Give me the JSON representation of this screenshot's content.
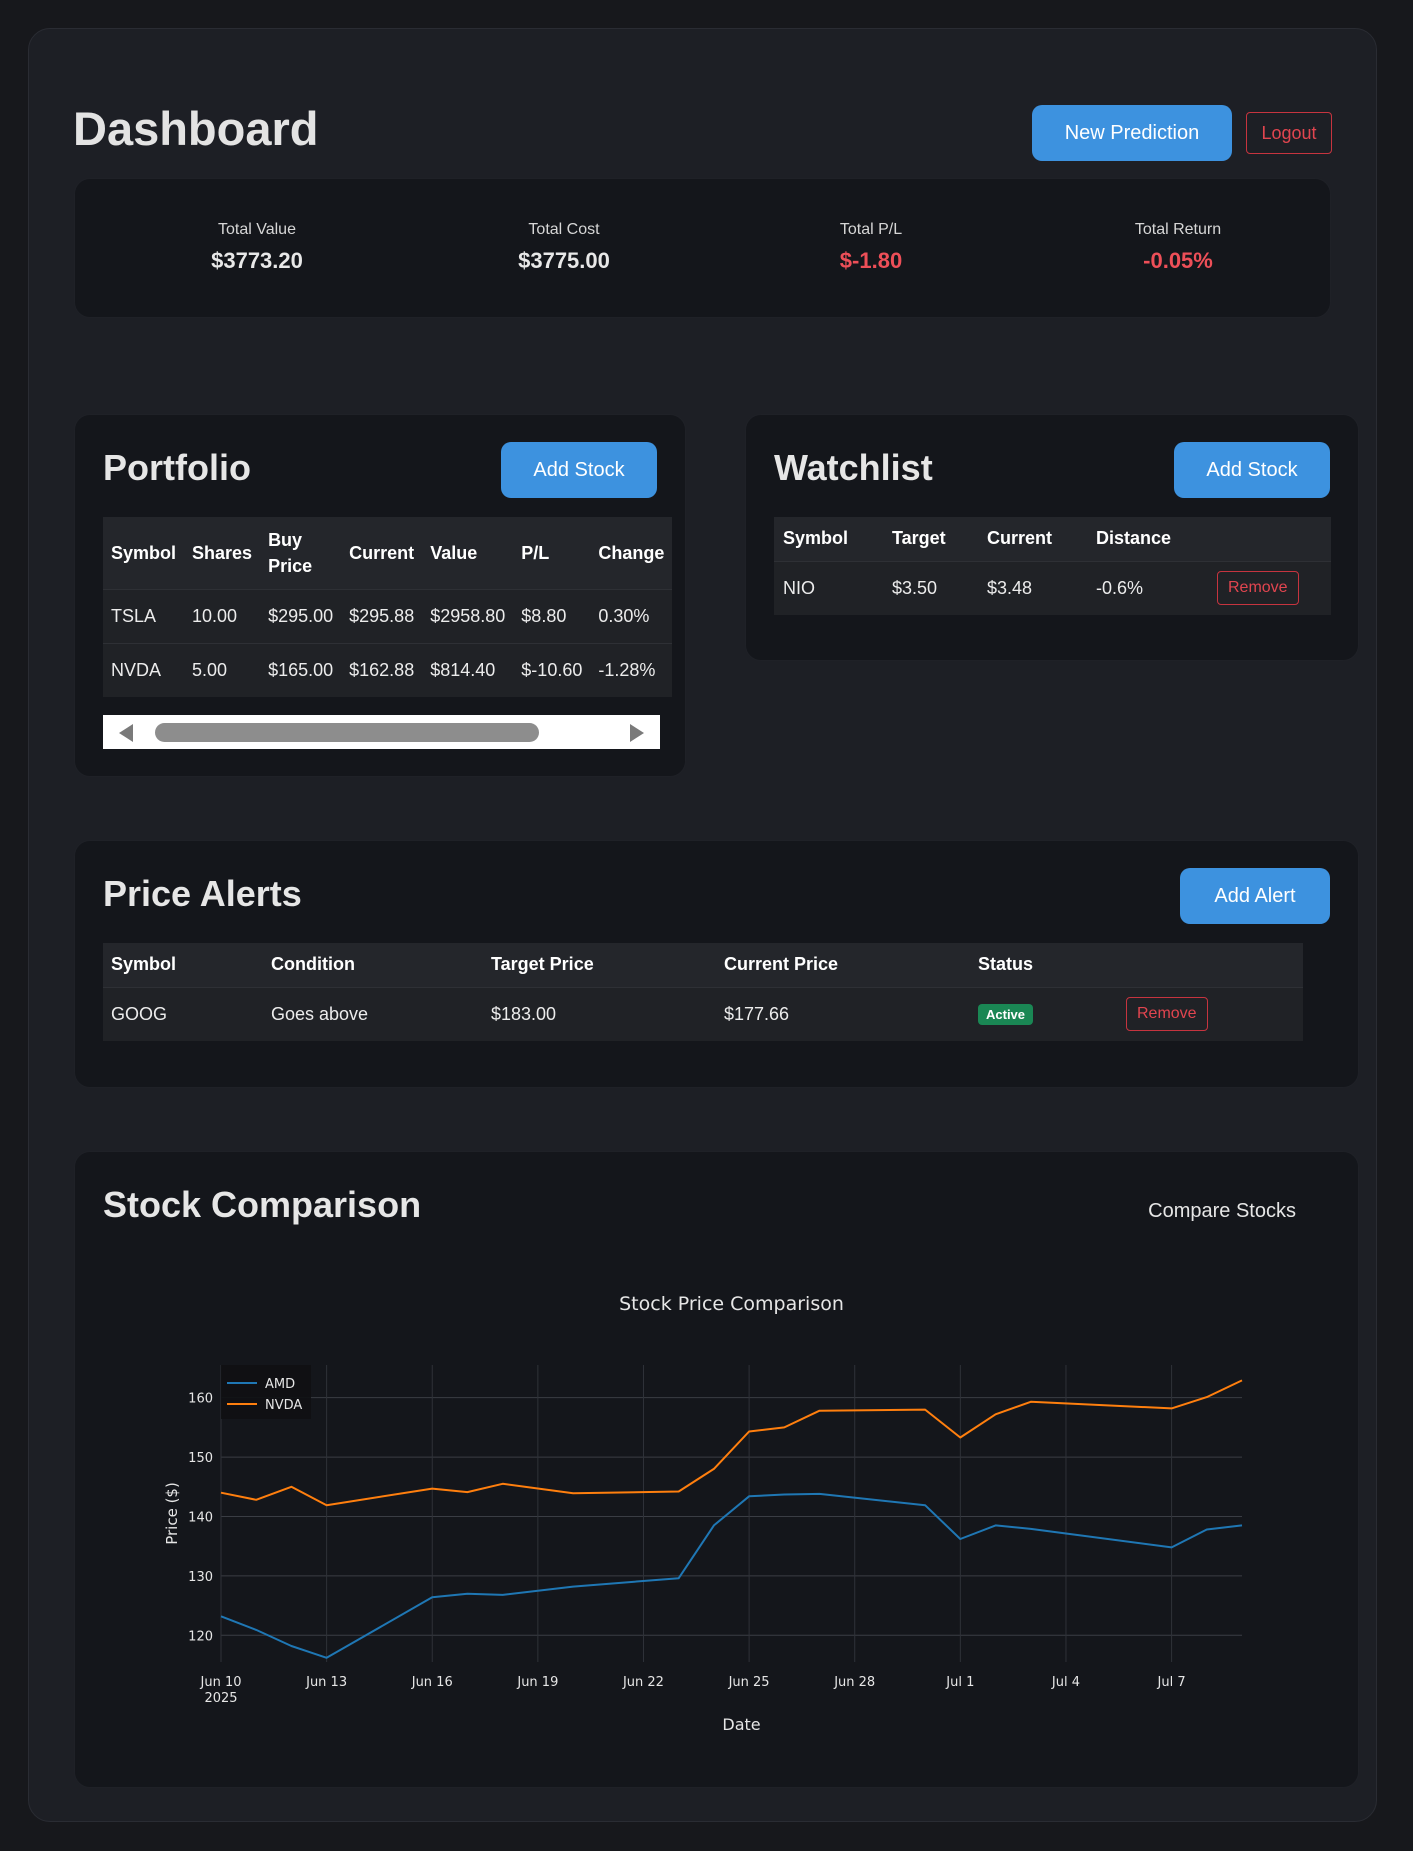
{
  "header": {
    "title": "Dashboard",
    "new_prediction_label": "New Prediction",
    "logout_label": "Logout"
  },
  "summary": [
    {
      "label": "Total Value",
      "value": "$3773.20"
    },
    {
      "label": "Total Cost",
      "value": "$3775.00"
    },
    {
      "label": "Total P/L",
      "value": "$-1.80"
    },
    {
      "label": "Total Return",
      "value": "-0.05%"
    }
  ],
  "portfolio": {
    "title": "Portfolio",
    "add_label": "Add Stock",
    "columns": [
      "Symbol",
      "Shares",
      "Buy Price",
      "Current",
      "Value",
      "P/L",
      "Change"
    ],
    "rows": [
      [
        "TSLA",
        "10.00",
        "$295.00",
        "$295.88",
        "$2958.80",
        "$8.80",
        "0.30%"
      ],
      [
        "NVDA",
        "5.00",
        "$165.00",
        "$162.88",
        "$814.40",
        "$-10.60",
        "-1.28%"
      ]
    ]
  },
  "watchlist": {
    "title": "Watchlist",
    "add_label": "Add Stock",
    "columns": [
      "Symbol",
      "Target",
      "Current",
      "Distance"
    ],
    "rows": [
      {
        "symbol": "NIO",
        "target": "$3.50",
        "current": "$3.48",
        "distance": "-0.6%",
        "action": "Remove"
      }
    ]
  },
  "alerts": {
    "title": "Price Alerts",
    "add_label": "Add Alert",
    "columns": [
      "Symbol",
      "Condition",
      "Target Price",
      "Current Price",
      "Status"
    ],
    "rows": [
      {
        "symbol": "GOOG",
        "condition": "Goes above",
        "target": "$183.00",
        "current": "$177.66",
        "status": "Active",
        "action": "Remove"
      }
    ]
  },
  "comparison": {
    "title": "Stock Comparison",
    "compare_label": "Compare Stocks"
  },
  "colors": {
    "accent": "#3d92df",
    "danger": "#e1454f",
    "success": "#1a8754",
    "amd": "#1f77b4",
    "nvda": "#ff7f0e"
  },
  "chart_data": {
    "type": "line",
    "title": "Stock Price Comparison",
    "xlabel": "Date",
    "ylabel": "Price ($)",
    "x_tick_labels": [
      "Jun 10\n2025",
      "Jun 13",
      "Jun 16",
      "Jun 19",
      "Jun 22",
      "Jun 25",
      "Jun 28",
      "Jul 1",
      "Jul 4",
      "Jul 7"
    ],
    "y_ticks": [
      120,
      130,
      140,
      150,
      160
    ],
    "ylim": [
      115.5,
      165.5
    ],
    "xlim": [
      "2025-06-10",
      "2025-07-09"
    ],
    "legend_position": "top-left",
    "grid": true,
    "series": [
      {
        "name": "AMD",
        "color": "#1f77b4",
        "x": [
          "2025-06-10",
          "2025-06-11",
          "2025-06-12",
          "2025-06-13",
          "2025-06-16",
          "2025-06-17",
          "2025-06-18",
          "2025-06-20",
          "2025-06-23",
          "2025-06-24",
          "2025-06-25",
          "2025-06-26",
          "2025-06-27",
          "2025-06-30",
          "2025-07-01",
          "2025-07-02",
          "2025-07-03",
          "2025-07-07",
          "2025-07-08",
          "2025-07-09"
        ],
        "y": [
          123.2,
          120.9,
          118.2,
          116.2,
          126.4,
          127.0,
          126.8,
          128.2,
          129.6,
          138.5,
          143.4,
          143.7,
          143.8,
          141.9,
          136.2,
          138.5,
          137.9,
          134.8,
          137.8,
          138.5
        ]
      },
      {
        "name": "NVDA",
        "color": "#ff7f0e",
        "x": [
          "2025-06-10",
          "2025-06-11",
          "2025-06-12",
          "2025-06-13",
          "2025-06-16",
          "2025-06-17",
          "2025-06-18",
          "2025-06-20",
          "2025-06-23",
          "2025-06-24",
          "2025-06-25",
          "2025-06-26",
          "2025-06-27",
          "2025-06-30",
          "2025-07-01",
          "2025-07-02",
          "2025-07-03",
          "2025-07-07",
          "2025-07-08",
          "2025-07-09"
        ],
        "y": [
          144.0,
          142.8,
          145.0,
          141.9,
          144.7,
          144.1,
          145.5,
          143.9,
          144.2,
          148.0,
          154.3,
          155.0,
          157.8,
          158.0,
          153.3,
          157.2,
          159.3,
          158.2,
          160.1,
          162.9
        ]
      }
    ]
  }
}
